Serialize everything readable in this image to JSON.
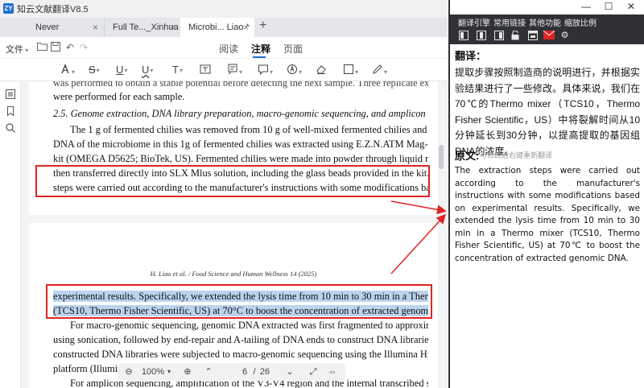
{
  "app": {
    "logo": "ZY",
    "title": "知云文献翻译V8.5"
  },
  "tabs": [
    {
      "label": "Never",
      "close": "×"
    },
    {
      "label": "Full Te..._Xinhua",
      "close": "×"
    },
    {
      "label": "Microbi... Liao *",
      "close": "×"
    }
  ],
  "add_tab": "+",
  "toolbar": {
    "file_label": "文件",
    "modes": [
      "阅读",
      "注释",
      "页面"
    ],
    "active_mode": "注释"
  },
  "document": {
    "lines": [
      "was performed to obtain a stable potential before detecting the next sample. Three replicate experiments",
      "were performed for each sample.",
      "2.5. Genome extraction, DNA library preparation, macro-genomic sequencing, and amplicon sequencing",
      "The 1 g of fermented chilies was removed from 10 g of well-mixed fermented chilies and then genomic",
      "DNA of the microbiome in this 1g of fermented chilies was extracted using E.Z.N.ATM Mag-Bind Soil DNA",
      "kit (OMEGA D5625; BioTek, US). Fermented chilies were made into powder through liquid nitrogen and",
      "then transferred directly into SLX Mlus solution, including the glass beads provided in the kit. The extraction",
      "steps were carried out according to the manufacturer's instructions with some modifications based on"
    ],
    "running_head": "H. Liao et al. / Food Science and Human Wellness 14 (2025)",
    "lines2": [
      "experimental results. Specifically, we extended the lysis time from 10 min to 30 min in a Thermo mixer",
      "(TCS10, Thermo Fisher Scientific, US) at 70°C to boost the concentration of extracted genomic DNA.",
      "For macro-genomic sequencing, genomic DNA extracted was first fragmented to approximately 350 bp",
      "using sonication, followed by end-repair and A-tailing of DNA ends to construct DNA libraries. Finally, the",
      "constructed DNA libraries were subjected to macro-genomic sequencing using the Illumina HiSeq 2500",
      "platform (Illumina",
      "For amplicon sequencing, amplification of the V3-V4 region and the internal transcribed spacer 1"
    ]
  },
  "pagebar": {
    "zoom": "100%",
    "page_current": "6",
    "page_separator": "/",
    "page_total": "26"
  },
  "translation_panel": {
    "menu": [
      "翻译引擎",
      "常用链接",
      "其他功能",
      "缩放比例"
    ],
    "translation_heading": "翻译：",
    "translation_text": "提取步骤按照制造商的说明进行，并根据实验结果进行了一些修改。具体来说，我们在70℃的Thermo mixer（TCS10，Thermo Fisher Scientific，US）中将裂解时间从10分钟延长到30分钟，以提高提取的基因组DNA的浓度。",
    "original_heading": "原文:",
    "original_hint": "可修改后右键重新翻译",
    "original_text": "The extraction steps were carried out according to the manufacturer's instructions with some modifications based on experimental results. Specifically, we extended the lysis time from 10 min to 30 min in a Thermo mixer (TCS10, Thermo Fisher Scientific, US) at 70℃ to boost the concentration of extracted genomic DNA."
  },
  "colors": {
    "highlight": "#bcd3ee",
    "annotation_red": "#e02424",
    "panel_dark": "#2f3136",
    "accent": "#1f6fd1"
  }
}
